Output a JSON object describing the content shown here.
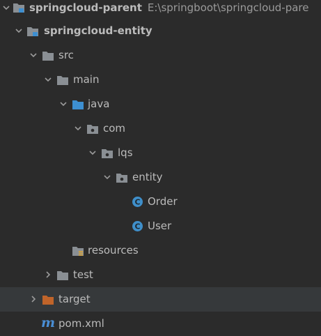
{
  "project_tree": {
    "root": {
      "name": "springcloud-parent",
      "path": "E:\\springboot\\springcloud-pare"
    },
    "module": {
      "name": "springcloud-entity"
    },
    "src": "src",
    "main": "main",
    "java": "java",
    "com": "com",
    "lqs": "lqs",
    "entity": "entity",
    "order_class": "Order",
    "user_class": "User",
    "resources": "resources",
    "test": "test",
    "target": "target",
    "pom": "pom.xml"
  },
  "icons": {
    "module_folder": "module-folder-icon",
    "folder": "folder-icon",
    "source_folder": "source-folder-icon",
    "package": "package-icon",
    "class": "class-icon",
    "resources_folder": "resources-folder-icon",
    "excluded_folder": "excluded-folder-icon",
    "maven": "maven-icon"
  },
  "colors": {
    "background": "#2b2b2b",
    "text": "#bbbbbb",
    "folder": "#8a8f94",
    "source_folder": "#3d8fd1",
    "excluded_folder": "#c0642a",
    "class_icon": "#3f8fca",
    "maven_icon": "#4a8fd6"
  }
}
